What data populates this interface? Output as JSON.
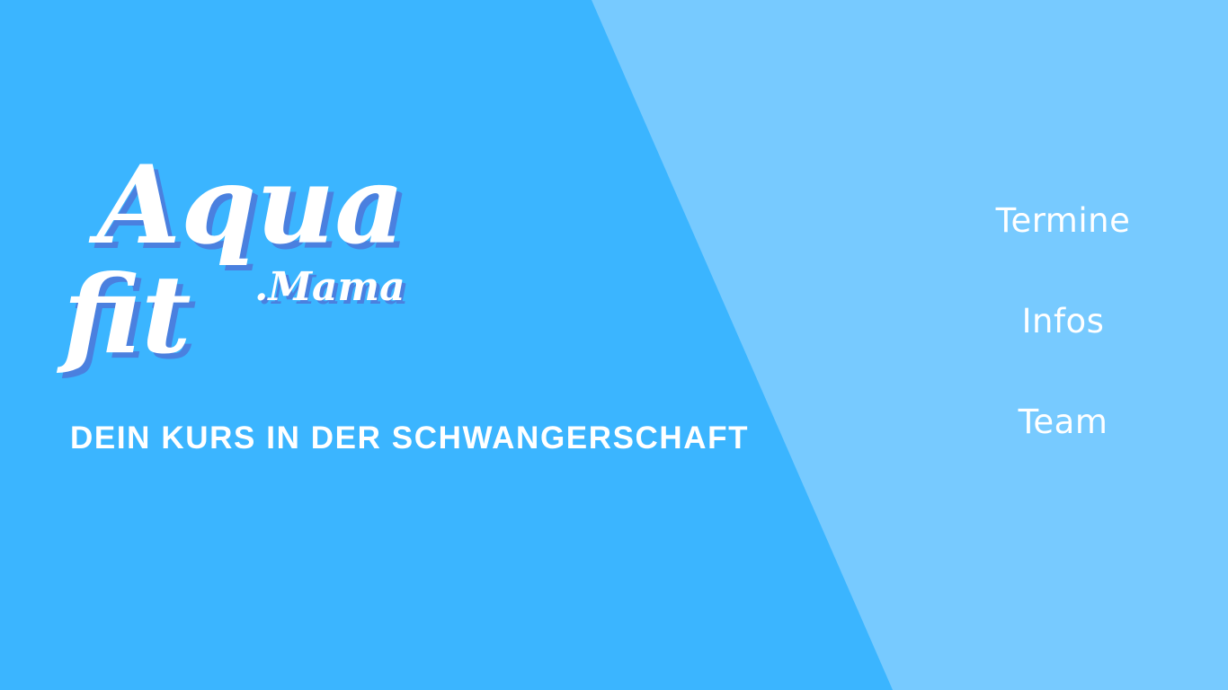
{
  "colors": {
    "background_primary": "#3bb5ff",
    "background_secondary": "#77caff",
    "logo_text": "#ffffff",
    "logo_shadow": "#4a80df",
    "text": "#ffffff"
  },
  "logo": {
    "line1": "Aqua",
    "line2": "fit",
    "suffix": ".Mama"
  },
  "hero": {
    "tagline": "DEIN KURS IN DER SCHWANGERSCHAFT"
  },
  "nav": {
    "items": [
      {
        "label": "Termine"
      },
      {
        "label": "Infos"
      },
      {
        "label": "Team"
      }
    ]
  }
}
